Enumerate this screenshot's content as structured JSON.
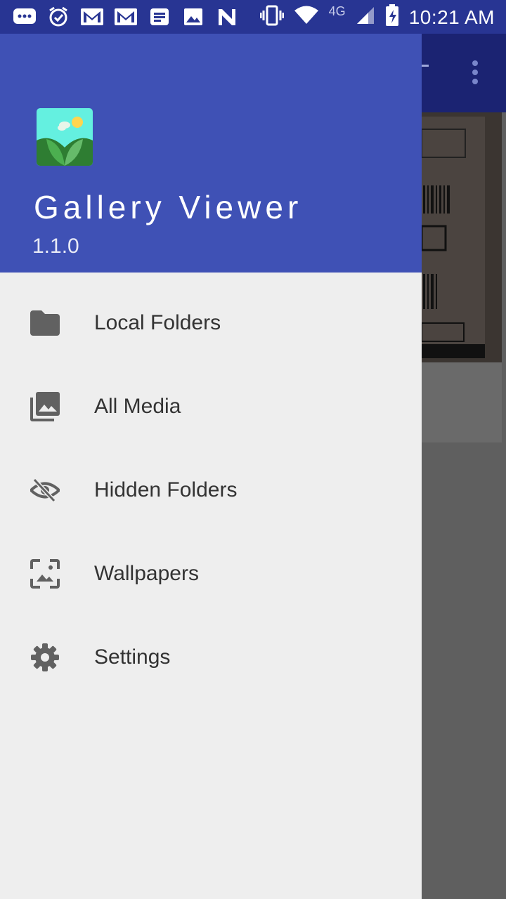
{
  "status_bar": {
    "time": "10:21 AM",
    "network": "4G",
    "icons": [
      "message-icon",
      "alarm-icon",
      "gmail-icon",
      "gmail-icon",
      "news-icon",
      "image-icon",
      "n-icon",
      "vibrate-icon",
      "wifi-icon",
      "signal-icon",
      "battery-charging-icon"
    ]
  },
  "drawer": {
    "app_name": "Gallery Viewer",
    "version": "1.1.0",
    "items": [
      {
        "label": "Local Folders",
        "icon": "folder-icon"
      },
      {
        "label": "All Media",
        "icon": "photo-library-icon"
      },
      {
        "label": "Hidden Folders",
        "icon": "eye-off-icon"
      },
      {
        "label": "Wallpapers",
        "icon": "wallpaper-icon"
      },
      {
        "label": "Settings",
        "icon": "gear-icon"
      }
    ]
  },
  "colors": {
    "primary": "#3f51b5",
    "primary_dark": "#283593",
    "drawer_bg": "#eeeeee",
    "icon": "#616161",
    "text": "#333333"
  }
}
